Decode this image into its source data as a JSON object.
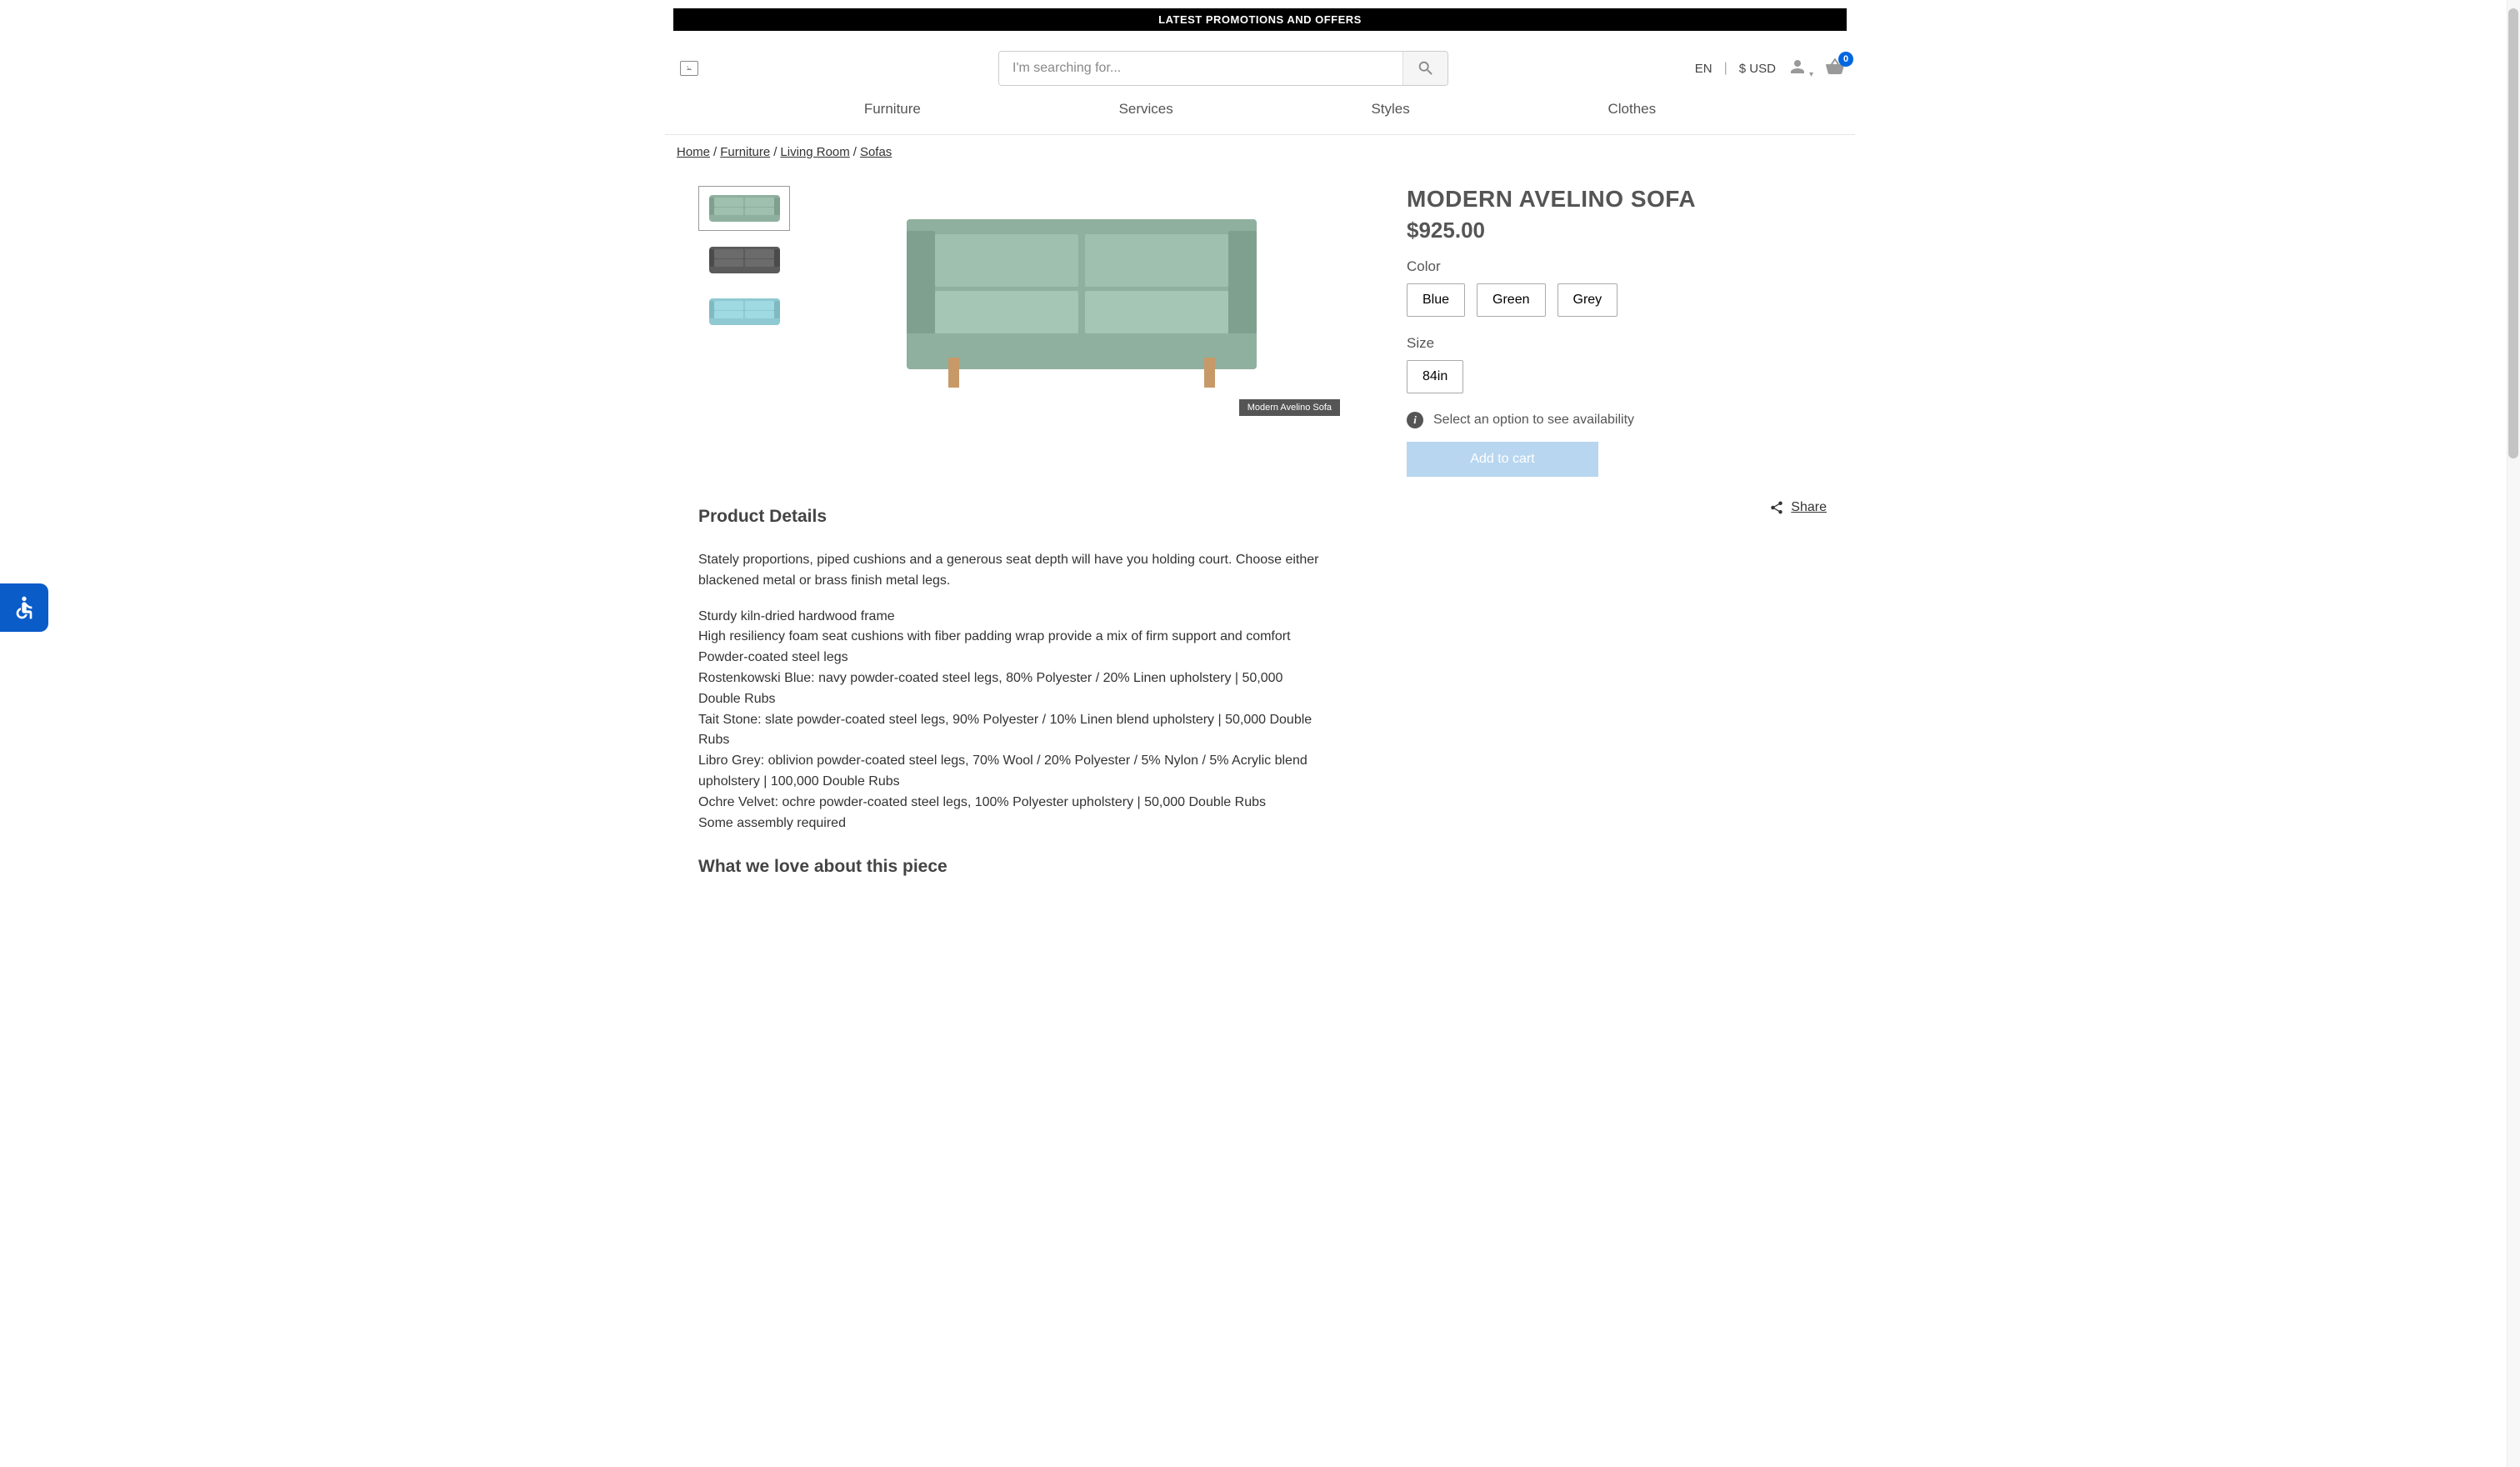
{
  "promo_banner": "LATEST PROMOTIONS AND OFFERS",
  "search": {
    "placeholder": "I'm searching for..."
  },
  "header": {
    "language": "EN",
    "currency": "$ USD",
    "cart_count": "0"
  },
  "nav": [
    "Furniture",
    "Services",
    "Styles",
    "Clothes"
  ],
  "breadcrumb": [
    "Home",
    "Furniture",
    "Living Room",
    "Sofas"
  ],
  "product": {
    "title": "MODERN AVELINO SOFA",
    "price": "$925.00",
    "color_label": "Color",
    "colors": [
      "Blue",
      "Green",
      "Grey"
    ],
    "size_label": "Size",
    "sizes": [
      "84in"
    ],
    "availability_text": "Select an option to see availability",
    "add_to_cart": "Add to cart",
    "share": "Share",
    "image_caption": "Modern Avelino Sofa",
    "thumb_colors": [
      "#8fb09e",
      "#5b5b5b",
      "#8fc9d1"
    ]
  },
  "details": {
    "heading": "Product Details",
    "intro": "Stately proportions, piped cushions and a generous seat depth will have you holding court. Choose either blackened metal or brass finish metal legs.",
    "lines": [
      "Sturdy kiln-dried hardwood frame",
      "High resiliency foam seat cushions with fiber padding wrap provide a mix of firm support and comfort",
      "Powder-coated steel legs",
      "Rostenkowski Blue: navy powder-coated steel legs, 80% Polyester / 20% Linen upholstery | 50,000 Double Rubs",
      "Tait Stone: slate powder-coated steel legs, 90% Polyester / 10% Linen blend upholstery | 50,000 Double Rubs",
      "Libro Grey: oblivion powder-coated steel legs, 70% Wool / 20% Polyester / 5% Nylon / 5% Acrylic blend upholstery | 100,000 Double Rubs",
      "Ochre Velvet: ochre powder-coated steel legs, 100% Polyester upholstery | 50,000 Double Rubs",
      "Some assembly required"
    ],
    "love_heading": "What we love about this piece"
  }
}
